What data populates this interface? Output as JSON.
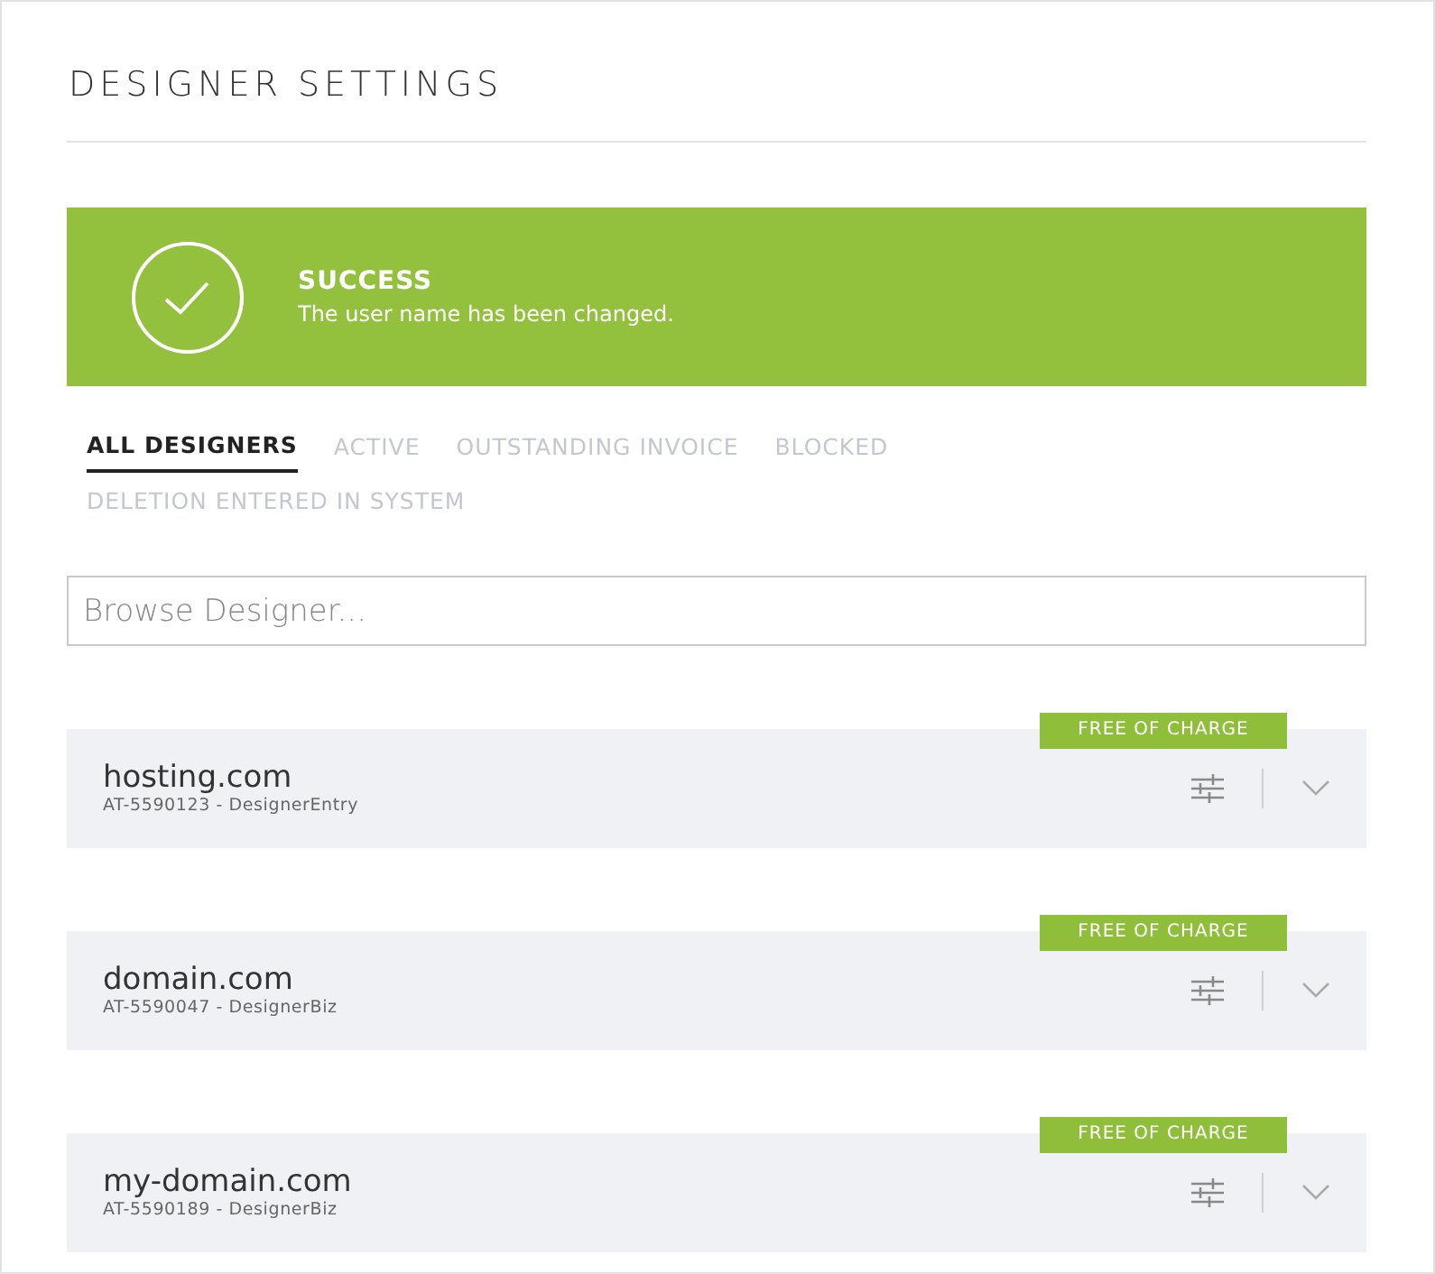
{
  "page": {
    "title": "DESIGNER SETTINGS"
  },
  "alert": {
    "title": "SUCCESS",
    "message": "The user name has been changed."
  },
  "tabs": [
    {
      "label": "ALL DESIGNERS",
      "selected": true
    },
    {
      "label": "ACTIVE",
      "selected": false
    },
    {
      "label": "OUTSTANDING INVOICE",
      "selected": false
    },
    {
      "label": "BLOCKED",
      "selected": false
    },
    {
      "label": "DELETION ENTERED IN SYSTEM",
      "selected": false
    }
  ],
  "search": {
    "placeholder": "Browse Designer..."
  },
  "designers": [
    {
      "domain": "hosting.com",
      "details": "AT-5590123 - DesignerEntry",
      "badge": "FREE OF CHARGE"
    },
    {
      "domain": "domain.com",
      "details": "AT-5590047 - DesignerBiz",
      "badge": "FREE OF CHARGE"
    },
    {
      "domain": "my-domain.com",
      "details": "AT-5590189 - DesignerBiz",
      "badge": "FREE OF CHARGE"
    }
  ]
}
